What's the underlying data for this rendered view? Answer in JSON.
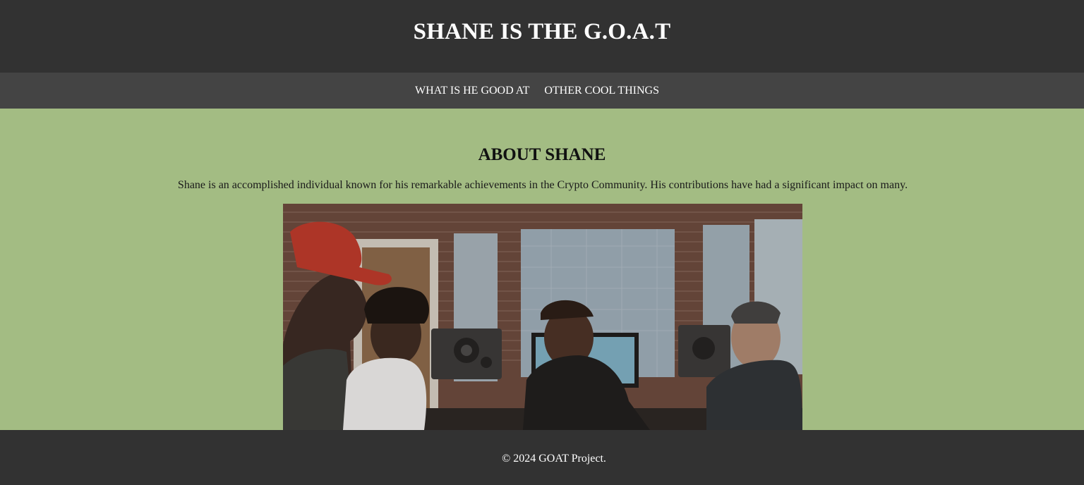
{
  "header": {
    "title": "SHANE IS THE G.O.A.T"
  },
  "nav": {
    "items": [
      {
        "label": "WHAT IS HE GOOD AT"
      },
      {
        "label": "OTHER COOL THINGS"
      }
    ]
  },
  "main": {
    "heading": "ABOUT SHANE",
    "description": "Shane is an accomplished individual known for his remarkable achievements in the Crypto Community. His contributions have had a significant impact on many.",
    "image_icon": "photo-studio-image"
  },
  "footer": {
    "text": "© 2024 GOAT Project."
  },
  "colors": {
    "header_bg": "#323232",
    "nav_bg": "#444444",
    "main_bg": "#a3bc83",
    "footer_bg": "#323232",
    "text_light": "#ffffff"
  }
}
